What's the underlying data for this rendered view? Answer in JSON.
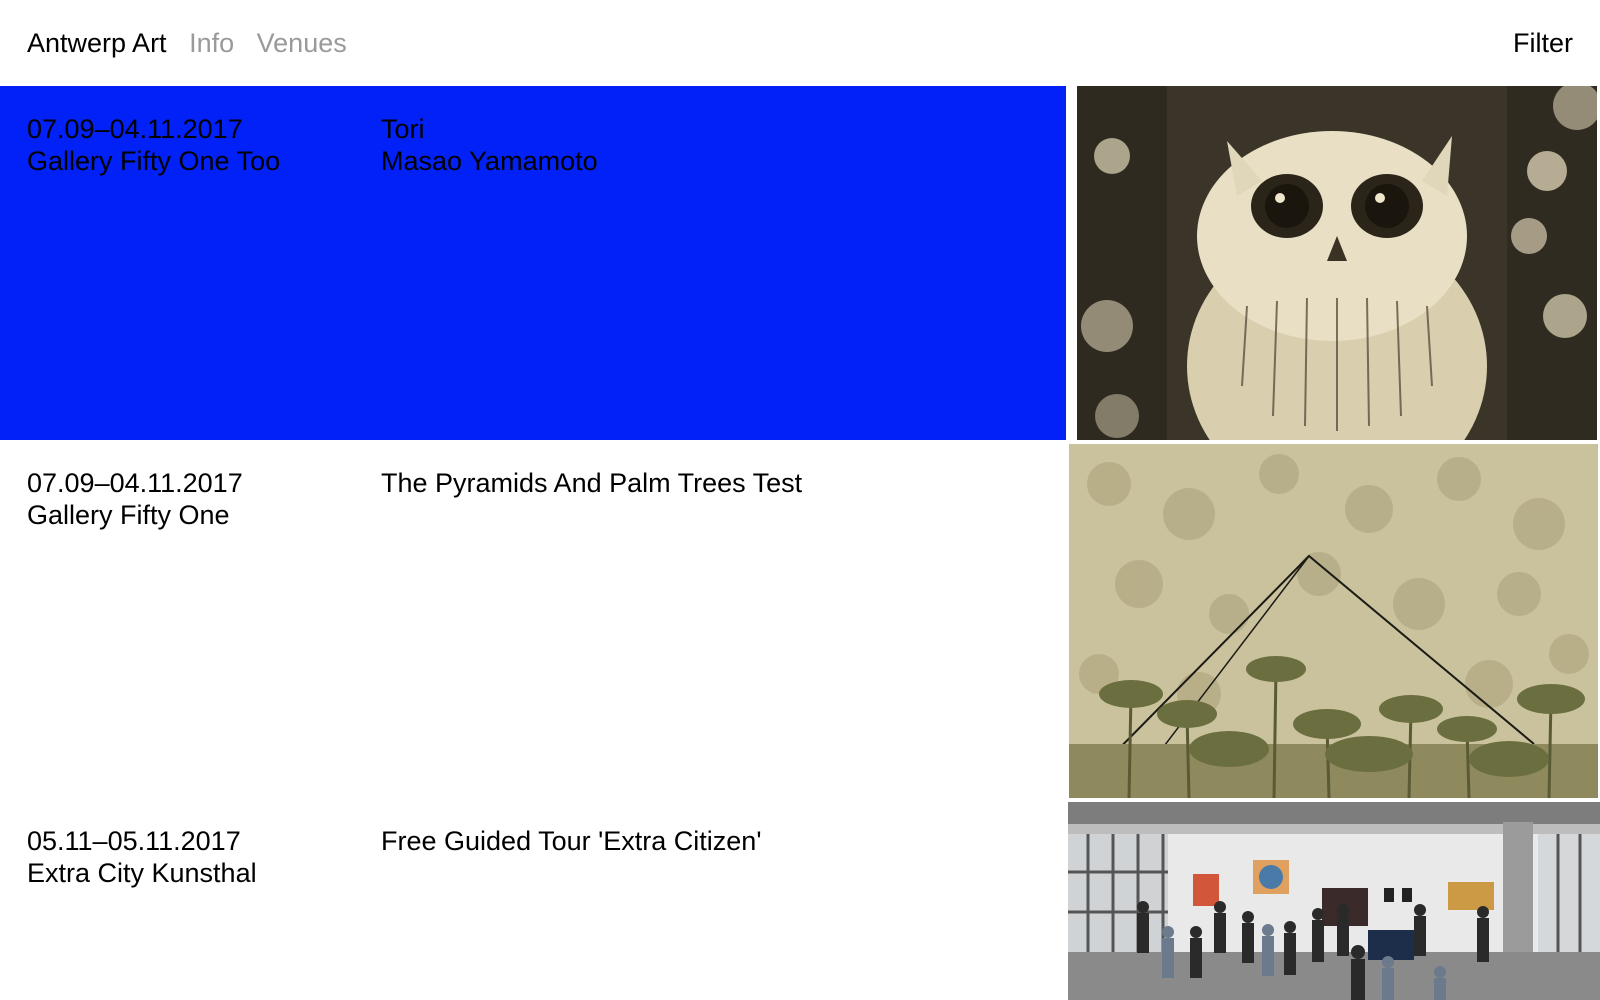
{
  "header": {
    "brand": "Antwerp Art",
    "nav": [
      "Info",
      "Venues"
    ],
    "filter_label": "Filter"
  },
  "colors": {
    "highlight": "#0121f7",
    "muted_nav": "#9a9a9a"
  },
  "events": [
    {
      "dates": "07.09–04.11.2017",
      "venue": "Gallery Fifty One Too",
      "title": "Tori",
      "artist": "Masao Yamamoto",
      "highlighted": true,
      "image": "owl-photograph"
    },
    {
      "dates": "07.09–04.11.2017",
      "venue": "Gallery Fifty One",
      "title": "The Pyramids And Palm Trees Test",
      "artist": "",
      "highlighted": false,
      "image": "pyramid-palm-trees-artwork"
    },
    {
      "dates": "05.11–05.11.2017",
      "venue": "Extra City Kunsthal",
      "title": "Free Guided Tour 'Extra Citizen'",
      "artist": "",
      "highlighted": false,
      "image": "gallery-tour-crowd-photo"
    }
  ]
}
